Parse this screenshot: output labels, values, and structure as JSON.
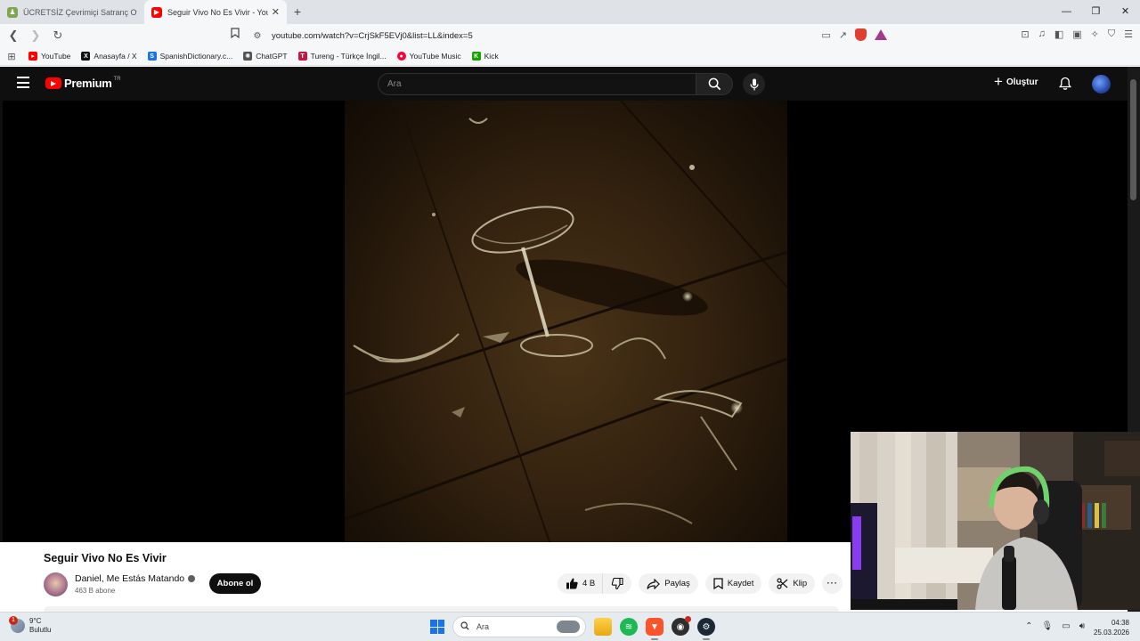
{
  "browser": {
    "tabs": [
      {
        "title": "ÜCRETSİZ Çevrimiçi Satranç Oynayın",
        "favicon": "chess-icon",
        "active": false
      },
      {
        "title": "Seguir Vivo No Es Vivir - YouT",
        "favicon": "youtube-icon",
        "active": true
      }
    ],
    "new_tab": "+",
    "url": "youtube.com/watch?v=CrjSkF5EVj0&list=LL&index=5",
    "bookmarks": [
      {
        "label": "YouTube",
        "icon": "youtube-icon",
        "color": "#ff0000"
      },
      {
        "label": "Anasayfa / X",
        "icon": "x-icon",
        "color": "#111111"
      },
      {
        "label": "SpanishDictionary.c...",
        "icon": "spanishdict-icon",
        "color": "#1a73e8"
      },
      {
        "label": "ChatGPT",
        "icon": "chatgpt-icon",
        "color": "#555555"
      },
      {
        "label": "Tureng - Türkçe İngil...",
        "icon": "tureng-icon",
        "color": "#c5163f"
      },
      {
        "label": "YouTube Music",
        "icon": "youtube-music-icon",
        "color": "#ff0033"
      },
      {
        "label": "Kick",
        "icon": "kick-icon",
        "color": "#18a100"
      }
    ]
  },
  "youtube": {
    "brand": "Premium",
    "region": "TR",
    "search_placeholder": "Ara",
    "create_label": "Oluştur",
    "video": {
      "title": "Seguir Vivo No Es Vivir",
      "channel": "Daniel, Me Estás Matando",
      "subscribers": "463 B abone",
      "subscribe_label": "Abone ol",
      "likes": "4 B",
      "share_label": "Paylaş",
      "save_label": "Kaydet",
      "clip_label": "Klip"
    }
  },
  "taskbar": {
    "weather_temp": "9°C",
    "weather_desc": "Bulutlu",
    "weather_badge": "1",
    "search_label": "Ara",
    "time": "04:38",
    "date": "25.03.2026"
  }
}
